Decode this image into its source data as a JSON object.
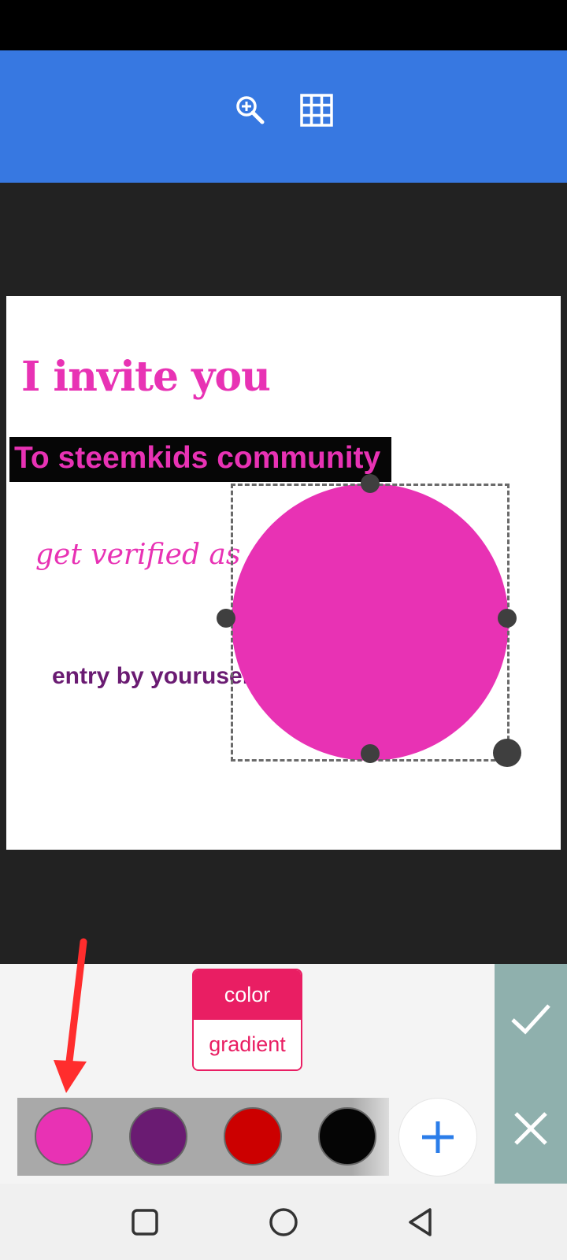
{
  "toolbar": {
    "icons": [
      "zoom-in-icon",
      "grid-icon"
    ],
    "background_color": "#3778e1"
  },
  "canvas": {
    "text_invite": "I invite you",
    "text_community": "To steemkids community",
    "text_verified": "get verified as a",
    "text_entry": "entry by youruser",
    "shape": {
      "type": "circle",
      "fill": "#e832b4"
    }
  },
  "style_tabs": {
    "active_label": "color",
    "inactive_label": "gradient"
  },
  "palette": {
    "swatches": [
      {
        "name": "pink",
        "color": "#e832b4"
      },
      {
        "name": "purple",
        "color": "#6a1b72"
      },
      {
        "name": "red",
        "color": "#cc0000"
      },
      {
        "name": "black",
        "color": "#050505"
      }
    ],
    "add_icon": "plus-icon"
  },
  "actions": {
    "confirm_icon": "check-icon",
    "cancel_icon": "close-icon"
  },
  "navigation": {
    "icons": [
      "recents-icon",
      "home-icon",
      "back-icon"
    ]
  },
  "accent_color": "#e91e63"
}
